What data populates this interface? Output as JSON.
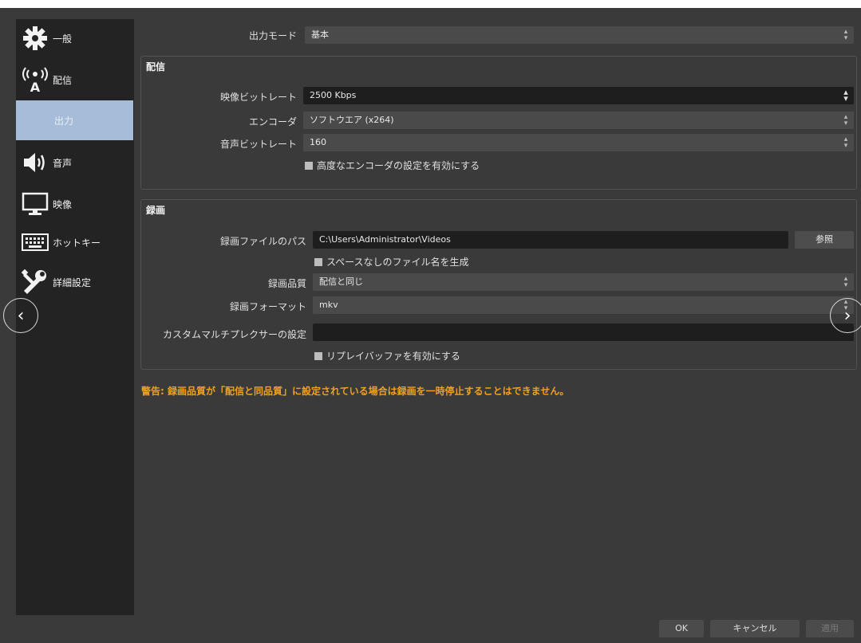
{
  "sidebar": {
    "items": [
      {
        "label": "一般",
        "icon": "gear-icon"
      },
      {
        "label": "配信",
        "icon": "broadcast-icon"
      },
      {
        "label": "出力",
        "icon": "output-icon"
      },
      {
        "label": "音声",
        "icon": "speaker-icon"
      },
      {
        "label": "映像",
        "icon": "monitor-icon"
      },
      {
        "label": "ホットキー",
        "icon": "keyboard-icon"
      },
      {
        "label": "詳細設定",
        "icon": "tools-icon"
      }
    ],
    "active_index": 2
  },
  "output_mode": {
    "label": "出力モード",
    "value": "基本"
  },
  "streaming": {
    "title": "配信",
    "video_bitrate": {
      "label": "映像ビットレート",
      "value": "2500 Kbps"
    },
    "encoder": {
      "label": "エンコーダ",
      "value": "ソフトウエア (x264)"
    },
    "audio_bitrate": {
      "label": "音声ビットレート",
      "value": "160"
    },
    "advanced_checkbox": "高度なエンコーダの設定を有効にする"
  },
  "recording": {
    "title": "録画",
    "path": {
      "label": "録画ファイルのパス",
      "value": "C:\\Users\\Administrator\\Videos"
    },
    "browse_label": "参照",
    "no_space_checkbox": "スペースなしのファイル名を生成",
    "quality": {
      "label": "録画品質",
      "value": "配信と同じ"
    },
    "format": {
      "label": "録画フォーマット",
      "value": "mkv"
    },
    "muxer": {
      "label": "カスタムマルチプレクサーの設定",
      "value": ""
    },
    "replay_checkbox": "リプレイバッファを有効にする"
  },
  "warning": "警告: 録画品質が「配信と同品質」に設定されている場合は録画を一時停止することはできません。",
  "buttons": {
    "ok": "OK",
    "cancel": "キャンセル",
    "apply": "適用"
  },
  "colors": {
    "accent": "#a6bcd8",
    "warning": "#f0a020"
  }
}
